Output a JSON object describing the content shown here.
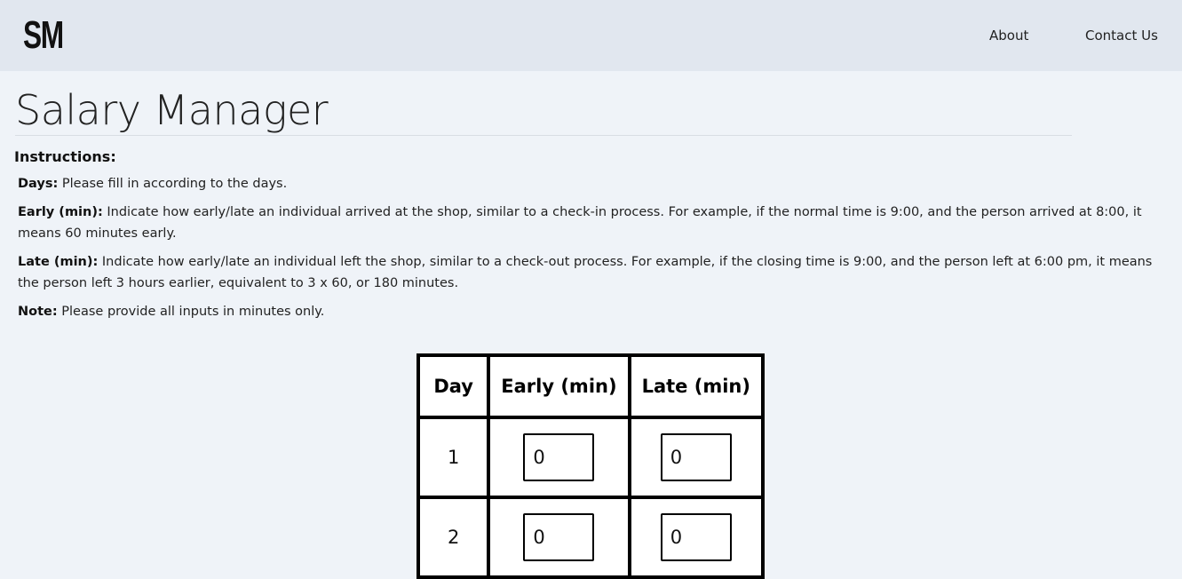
{
  "header": {
    "logo": "SM",
    "nav": [
      {
        "label": "About"
      },
      {
        "label": "Contact Us"
      }
    ]
  },
  "main": {
    "title": "Salary Manager",
    "instructions_heading": "Instructions:",
    "instructions": [
      {
        "term": "Days:",
        "text": " Please fill in according to the days."
      },
      {
        "term": "Early (min):",
        "text": " Indicate how early/late an individual arrived at the shop, similar to a check-in process. For example, if the normal time is 9:00, and the person arrived at 8:00, it means 60 minutes early."
      },
      {
        "term": "Late (min):",
        "text": " Indicate how early/late an individual left the shop, similar to a check-out process. For example, if the closing time is 9:00, and the person left at 6:00 pm, it means the person left 3 hours earlier, equivalent to 3 x 60, or 180 minutes."
      },
      {
        "term": "Note:",
        "text": " Please provide all inputs in minutes only."
      }
    ]
  },
  "table": {
    "headers": [
      "Day",
      "Early (min)",
      "Late (min)"
    ],
    "rows": [
      {
        "day": "1",
        "early": "0",
        "late": "0"
      },
      {
        "day": "2",
        "early": "0",
        "late": "0"
      }
    ]
  },
  "colors": {
    "header_bg": "#e1e7ef",
    "page_bg": "#eff3f8",
    "table_border": "#000000"
  }
}
